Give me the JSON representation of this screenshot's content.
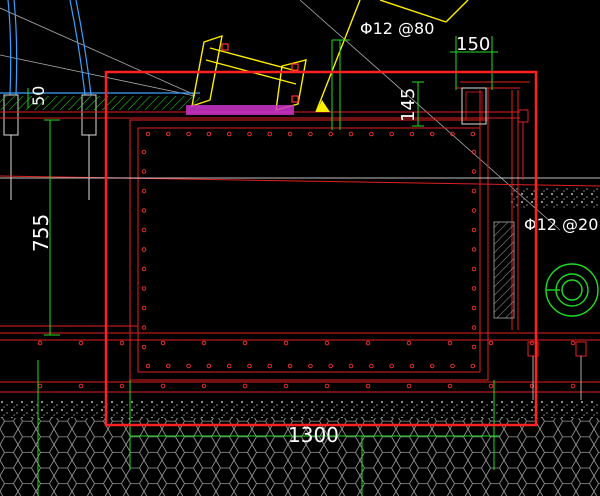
{
  "drawing": {
    "dimensions": {
      "d50": "50",
      "d755": "755",
      "d145": "145",
      "d150": "150",
      "d1300": "1300"
    },
    "rebar_labels": {
      "top": "Φ12 @80",
      "right": "Φ12 @20"
    }
  },
  "colors": {
    "background": "#000000",
    "selection": "#ff2020",
    "outline": "#e02020",
    "dimension": "#22dd22",
    "yellow": "#ffee00",
    "magenta": "#cc33cc",
    "white": "#ffffff",
    "cyan": "#3aa0ff",
    "gray": "#aaaaaa"
  }
}
